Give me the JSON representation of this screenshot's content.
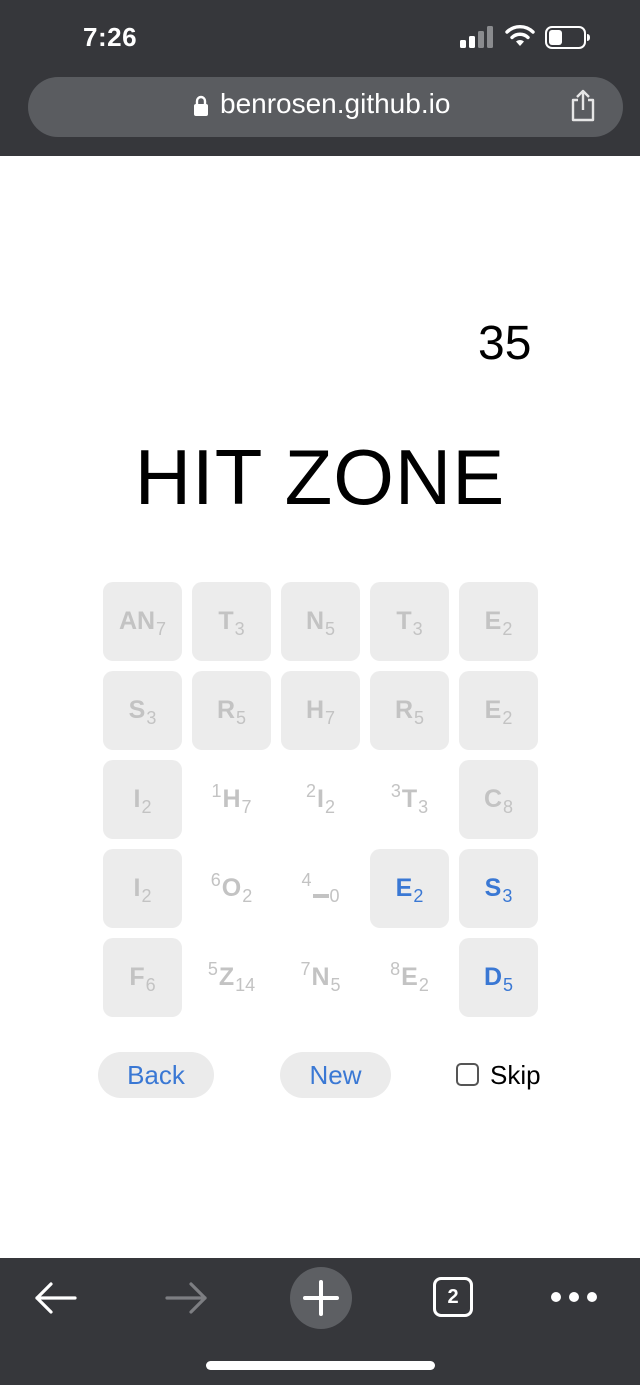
{
  "status_bar": {
    "time": "7:26"
  },
  "browser": {
    "url": "benrosen.github.io",
    "tab_count": "2"
  },
  "game": {
    "score": "35",
    "title": "HIT ZONE",
    "tiles": [
      {
        "letter": "AN",
        "sub": "7",
        "sup": "",
        "state": "filled"
      },
      {
        "letter": "T",
        "sub": "3",
        "sup": "",
        "state": "filled"
      },
      {
        "letter": "N",
        "sub": "5",
        "sup": "",
        "state": "filled"
      },
      {
        "letter": "T",
        "sub": "3",
        "sup": "",
        "state": "filled"
      },
      {
        "letter": "E",
        "sub": "2",
        "sup": "",
        "state": "filled"
      },
      {
        "letter": "S",
        "sub": "3",
        "sup": "",
        "state": "filled"
      },
      {
        "letter": "R",
        "sub": "5",
        "sup": "",
        "state": "filled"
      },
      {
        "letter": "H",
        "sub": "7",
        "sup": "",
        "state": "filled"
      },
      {
        "letter": "R",
        "sub": "5",
        "sup": "",
        "state": "filled"
      },
      {
        "letter": "E",
        "sub": "2",
        "sup": "",
        "state": "filled"
      },
      {
        "letter": "I",
        "sub": "2",
        "sup": "",
        "state": "filled"
      },
      {
        "letter": "H",
        "sub": "7",
        "sup": "1",
        "state": "empty"
      },
      {
        "letter": "I",
        "sub": "2",
        "sup": "2",
        "state": "empty"
      },
      {
        "letter": "T",
        "sub": "3",
        "sup": "3",
        "state": "empty"
      },
      {
        "letter": "C",
        "sub": "8",
        "sup": "",
        "state": "filled"
      },
      {
        "letter": "I",
        "sub": "2",
        "sup": "",
        "state": "filled"
      },
      {
        "letter": "O",
        "sub": "2",
        "sup": "6",
        "state": "empty"
      },
      {
        "letter": "_",
        "sub": "0",
        "sup": "4",
        "state": "empty"
      },
      {
        "letter": "E",
        "sub": "2",
        "sup": "",
        "state": "active"
      },
      {
        "letter": "S",
        "sub": "3",
        "sup": "",
        "state": "active"
      },
      {
        "letter": "F",
        "sub": "6",
        "sup": "",
        "state": "filled"
      },
      {
        "letter": "Z",
        "sub": "14",
        "sup": "5",
        "state": "empty"
      },
      {
        "letter": "N",
        "sub": "5",
        "sup": "7",
        "state": "empty"
      },
      {
        "letter": "E",
        "sub": "2",
        "sup": "8",
        "state": "empty"
      },
      {
        "letter": "D",
        "sub": "5",
        "sup": "",
        "state": "active"
      }
    ],
    "buttons": {
      "back": "Back",
      "new": "New"
    },
    "skip": {
      "label": "Skip",
      "checked": false
    }
  },
  "colors": {
    "chrome": "#36373b",
    "url_bar": "#5a5c60",
    "accent_blue": "#3a78d4",
    "tile_bg": "#ececec",
    "tile_text": "#c3c3c3"
  },
  "icons": [
    "lock-icon",
    "share-icon",
    "signal-icon",
    "wifi-icon",
    "battery-icon",
    "back-arrow-icon",
    "forward-arrow-icon",
    "plus-icon",
    "tabs-icon",
    "more-icon"
  ]
}
